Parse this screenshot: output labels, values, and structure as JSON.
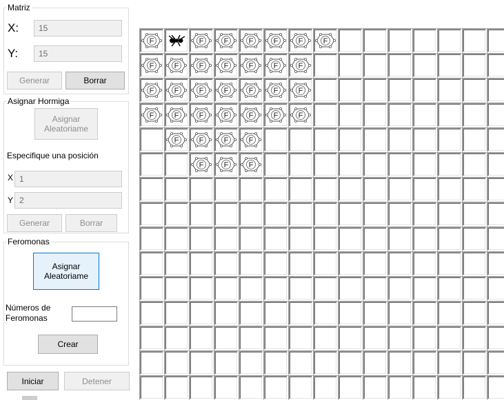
{
  "matriz": {
    "title": "Matriz",
    "x_label": "X:",
    "x_value": "15",
    "y_label": "Y:",
    "y_value": "15",
    "generar": "Generar",
    "borrar": "Borrar"
  },
  "hormiga": {
    "title": "Asignar Hormiga",
    "asignar_line1": "Asignar",
    "asignar_line2": "Aleatoriame",
    "especifique": "Especifique una posición",
    "x_label": "X",
    "x_value": "1",
    "y_label": "Y",
    "y_value": "2",
    "generar": "Generar",
    "borrar": "Borrar"
  },
  "feromonas": {
    "title": "Feromonas",
    "asignar_line1": "Asignar",
    "asignar_line2": "Aleatoriame",
    "numeros_line1": "Números de",
    "numeros_line2": "Feromonas",
    "numeros_value": "",
    "crear": "Crear"
  },
  "controls": {
    "iniciar": "Iniciar",
    "detener": "Detener"
  },
  "grid": {
    "rows": 15,
    "cols": 15,
    "pheromone_glyph": "F",
    "ant_cell": [
      0,
      1
    ],
    "pheromone_cells": [
      [
        0,
        0
      ],
      [
        0,
        2
      ],
      [
        0,
        3
      ],
      [
        0,
        4
      ],
      [
        0,
        5
      ],
      [
        0,
        6
      ],
      [
        0,
        7
      ],
      [
        1,
        0
      ],
      [
        1,
        1
      ],
      [
        1,
        2
      ],
      [
        1,
        3
      ],
      [
        1,
        4
      ],
      [
        1,
        5
      ],
      [
        1,
        6
      ],
      [
        2,
        0
      ],
      [
        2,
        1
      ],
      [
        2,
        2
      ],
      [
        2,
        3
      ],
      [
        2,
        4
      ],
      [
        2,
        5
      ],
      [
        2,
        6
      ],
      [
        3,
        0
      ],
      [
        3,
        1
      ],
      [
        3,
        2
      ],
      [
        3,
        3
      ],
      [
        3,
        4
      ],
      [
        3,
        5
      ],
      [
        3,
        6
      ],
      [
        4,
        1
      ],
      [
        4,
        2
      ],
      [
        4,
        3
      ],
      [
        4,
        4
      ],
      [
        5,
        2
      ],
      [
        5,
        3
      ],
      [
        5,
        4
      ]
    ]
  }
}
